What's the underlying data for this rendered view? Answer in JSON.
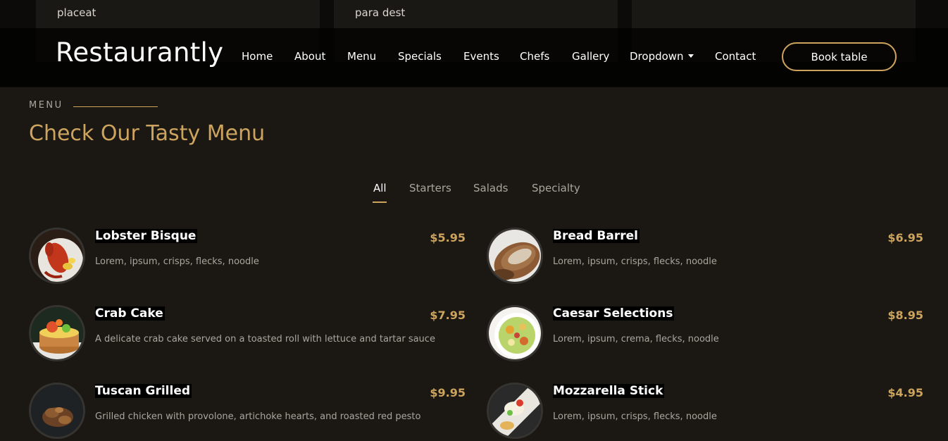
{
  "peek_cards": [
    {
      "text": "placeat"
    },
    {
      "text": "para dest"
    },
    {
      "text": ""
    }
  ],
  "header": {
    "logo": "Restaurantly",
    "nav": [
      "Home",
      "About",
      "Menu",
      "Specials",
      "Events",
      "Chefs",
      "Gallery",
      "Dropdown",
      "Contact"
    ],
    "book_button": "Book table"
  },
  "section": {
    "label": "MENU",
    "title": "Check Our Tasty Menu"
  },
  "filters": {
    "items": [
      "All",
      "Starters",
      "Salads",
      "Specialty"
    ],
    "active": "All"
  },
  "menu": [
    {
      "name": "Lobster Bisque",
      "price": "$5.95",
      "desc": "Lorem, ipsum, crisps, flecks, noodle",
      "image": "lobster-image"
    },
    {
      "name": "Bread Barrel",
      "price": "$6.95",
      "desc": "Lorem, ipsum, crisps, flecks, noodle",
      "image": "bread-image"
    },
    {
      "name": "Crab Cake",
      "price": "$7.95",
      "desc": "A delicate crab cake served on a toasted roll with lettuce and tartar sauce",
      "image": "crab-cake-image"
    },
    {
      "name": "Caesar Selections",
      "price": "$8.95",
      "desc": "Lorem, ipsum, crema, flecks, noodle",
      "image": "salad-image"
    },
    {
      "name": "Tuscan Grilled",
      "price": "$9.95",
      "desc": "Grilled chicken with provolone, artichoke hearts, and roasted red pesto",
      "image": "grilled-chicken-image"
    },
    {
      "name": "Mozzarella Stick",
      "price": "$4.95",
      "desc": "Lorem, ipsum, crisps, flecks, noodle",
      "image": "mozzarella-image"
    }
  ],
  "colors": {
    "accent": "#cda45e",
    "background": "#1b1814",
    "muted_text": "#aaa59d"
  }
}
